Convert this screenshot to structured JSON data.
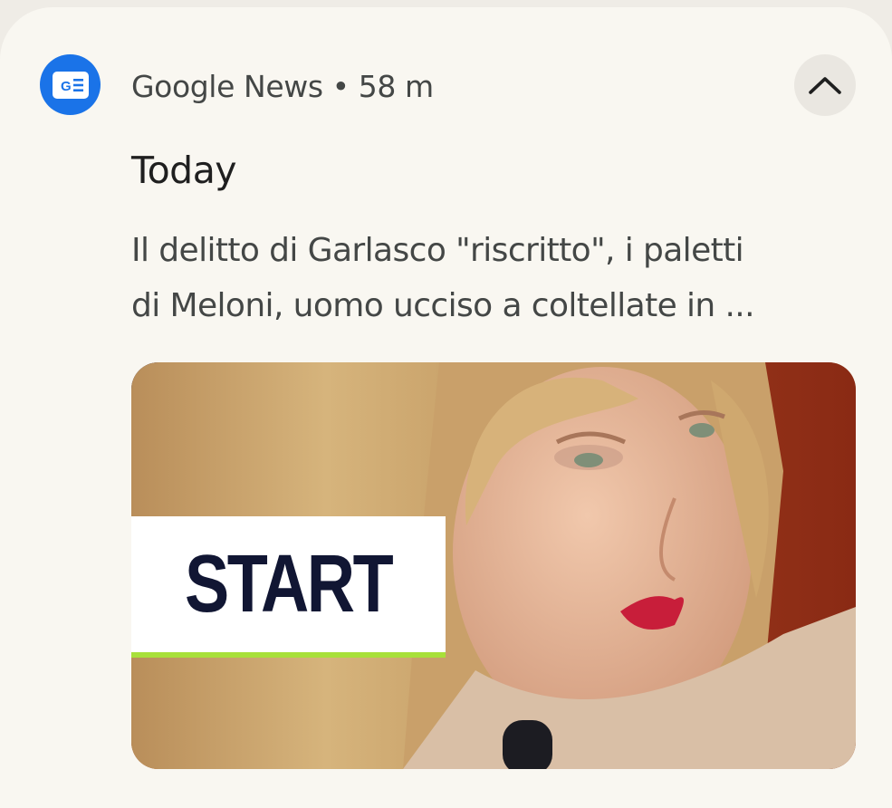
{
  "notification": {
    "app_name": "Google News",
    "separator": "•",
    "time": "58 m",
    "app_icon": "google-news-icon",
    "collapse_icon": "chevron-up-icon",
    "title": "Today",
    "body_lines": [
      "Il delitto di Garlasco \"riscritto\", i paletti",
      "di Meloni, uomo ucciso a coltellate in ..."
    ],
    "image_overlay_text": "START",
    "colors": {
      "background": "#f9f7f1",
      "app_icon_bg": "#1a73e8",
      "title": "#1f1f1f",
      "secondary_text": "#444746",
      "start_text": "#111633",
      "start_underline": "#a8e03a"
    }
  }
}
